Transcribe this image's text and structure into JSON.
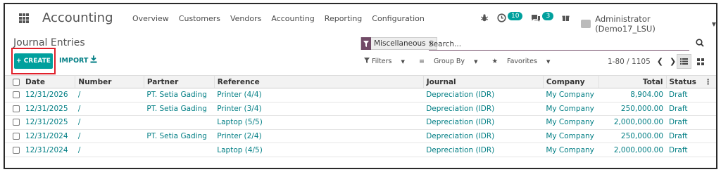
{
  "navbar": {
    "app_title": "Accounting",
    "menu": [
      "Overview",
      "Customers",
      "Vendors",
      "Accounting",
      "Reporting",
      "Configuration"
    ],
    "activity_count": "10",
    "messages_count": "3",
    "user": "Administrator (Demo17_LSU)"
  },
  "control": {
    "breadcrumb": "Journal Entries",
    "create_label": "+ CREATE",
    "import_label": "IMPORT",
    "facet_label": "Miscellaneous",
    "facet_close": "×",
    "search_placeholder": "Search...",
    "filters_label": "Filters",
    "groupby_label": "Group By",
    "favorites_label": "Favorites",
    "pager": "1-80 / 1105",
    "highlight_color": "#e0202a",
    "accent_color": "#00a09d",
    "brand_color": "#714b67"
  },
  "table": {
    "headers": {
      "date": "Date",
      "number": "Number",
      "partner": "Partner",
      "reference": "Reference",
      "journal": "Journal",
      "company": "Company",
      "total": "Total",
      "status": "Status"
    },
    "rows": [
      {
        "date": "12/31/2026",
        "number": "/",
        "partner": "PT. Setia Gading",
        "reference": "Printer (4/4)",
        "journal": "Depreciation (IDR)",
        "company": "My Company",
        "total": "8,904.00",
        "status": "Draft"
      },
      {
        "date": "12/31/2025",
        "number": "/",
        "partner": "PT. Setia Gading",
        "reference": "Printer (3/4)",
        "journal": "Depreciation (IDR)",
        "company": "My Company",
        "total": "250,000.00",
        "status": "Draft"
      },
      {
        "date": "12/31/2025",
        "number": "/",
        "partner": "",
        "reference": "Laptop (5/5)",
        "journal": "Depreciation (IDR)",
        "company": "My Company",
        "total": "2,000,000.00",
        "status": "Draft"
      },
      {
        "date": "12/31/2024",
        "number": "/",
        "partner": "PT. Setia Gading",
        "reference": "Printer (2/4)",
        "journal": "Depreciation (IDR)",
        "company": "My Company",
        "total": "250,000.00",
        "status": "Draft"
      },
      {
        "date": "12/31/2024",
        "number": "/",
        "partner": "",
        "reference": "Laptop (4/5)",
        "journal": "Depreciation (IDR)",
        "company": "My Company",
        "total": "2,000,000.00",
        "status": "Draft"
      }
    ]
  }
}
